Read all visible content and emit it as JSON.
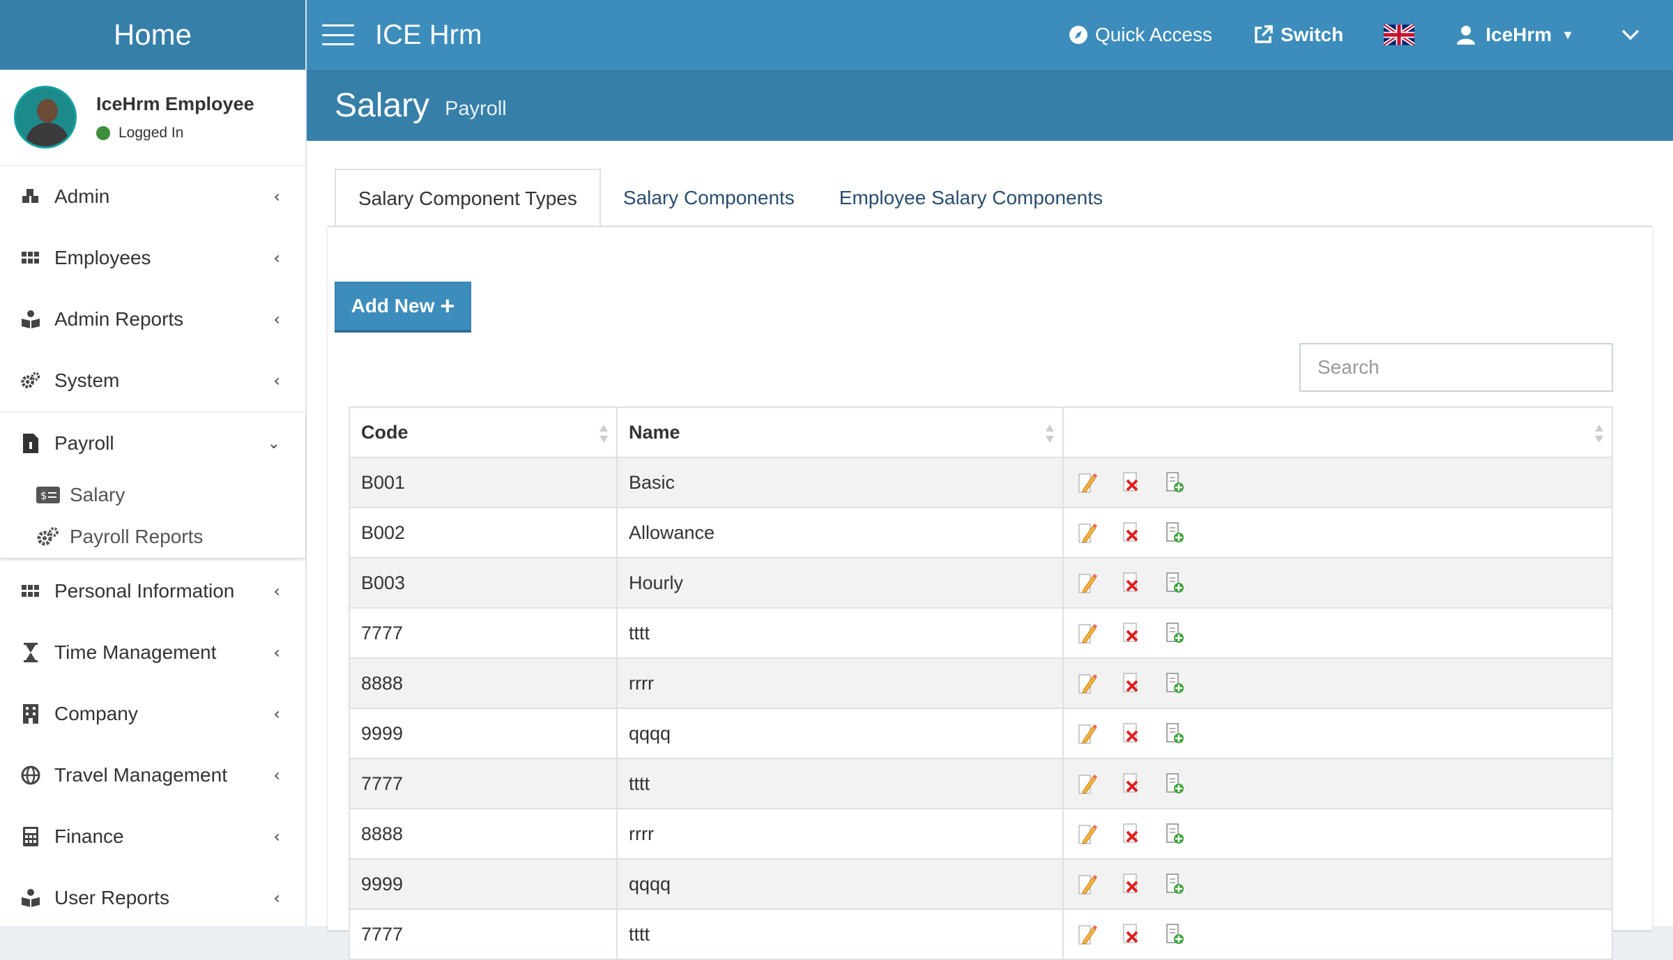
{
  "sidebar": {
    "logo": "Home",
    "user": {
      "name": "IceHrm Employee",
      "status": "Logged In"
    },
    "items_top": [
      {
        "label": "Admin",
        "icon": "cubes-icon"
      },
      {
        "label": "Employees",
        "icon": "grid-icon"
      },
      {
        "label": "Admin Reports",
        "icon": "book-reader-icon"
      },
      {
        "label": "System",
        "icon": "cogs-icon"
      }
    ],
    "open_item": {
      "label": "Payroll",
      "icon": "file-invoice-icon"
    },
    "subitems": [
      {
        "label": "Salary",
        "icon": "money-bill-icon"
      },
      {
        "label": "Payroll Reports",
        "icon": "cogs-icon"
      }
    ],
    "items_bottom": [
      {
        "label": "Personal Information",
        "icon": "grid-icon"
      },
      {
        "label": "Time Management",
        "icon": "hourglass-icon"
      },
      {
        "label": "Company",
        "icon": "building-icon"
      },
      {
        "label": "Travel Management",
        "icon": "globe-icon"
      },
      {
        "label": "Finance",
        "icon": "calculator-icon"
      },
      {
        "label": "User Reports",
        "icon": "book-reader-icon"
      }
    ]
  },
  "topbar": {
    "brand": "ICE Hrm",
    "quick_access": "Quick Access",
    "switch": "Switch",
    "user": "IceHrm"
  },
  "header": {
    "title": "Salary",
    "subtitle": "Payroll"
  },
  "tabs": [
    "Salary Component Types",
    "Salary Components",
    "Employee Salary Components"
  ],
  "toolbar": {
    "add_label": "Add New"
  },
  "search": {
    "placeholder": "Search",
    "value": ""
  },
  "table": {
    "headers": [
      "Code",
      "Name"
    ],
    "rows": [
      {
        "code": "B001",
        "name": "Basic"
      },
      {
        "code": "B002",
        "name": "Allowance"
      },
      {
        "code": "B003",
        "name": "Hourly"
      },
      {
        "code": "7777",
        "name": "tttt"
      },
      {
        "code": "8888",
        "name": "rrrr"
      },
      {
        "code": "9999",
        "name": "qqqq"
      },
      {
        "code": "7777",
        "name": "tttt"
      },
      {
        "code": "8888",
        "name": "rrrr"
      },
      {
        "code": "9999",
        "name": "qqqq"
      },
      {
        "code": "7777",
        "name": "tttt"
      }
    ]
  },
  "colors": {
    "topbar": "#3c8dbc",
    "header": "#367fa9",
    "button": "#3c8dbc"
  }
}
